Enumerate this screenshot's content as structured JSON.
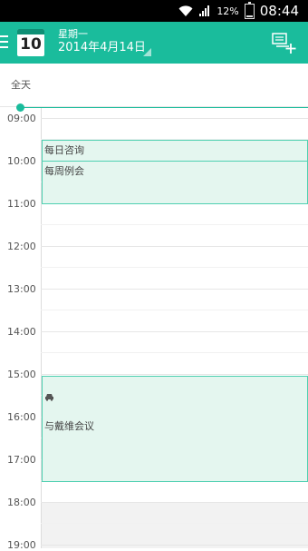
{
  "status_bar": {
    "battery_percent": "12%",
    "time": "08:44"
  },
  "app_bar": {
    "calendar_day": "10",
    "weekday": "星期一",
    "date": "2014年4月14日"
  },
  "all_day": {
    "label": "全天"
  },
  "hours": [
    "09:00",
    "10:00",
    "11:00",
    "12:00",
    "13:00",
    "14:00",
    "15:00",
    "16:00",
    "17:00",
    "18:00",
    "19:00"
  ],
  "events": [
    {
      "title": "每日咨询"
    },
    {
      "title": "每周例会"
    },
    {
      "title": "与戴维会议",
      "icon": "car-icon"
    }
  ],
  "colors": {
    "accent": "#1abc9c",
    "event_fill": "#e4f6ef",
    "event_border": "#4fd0b1"
  }
}
